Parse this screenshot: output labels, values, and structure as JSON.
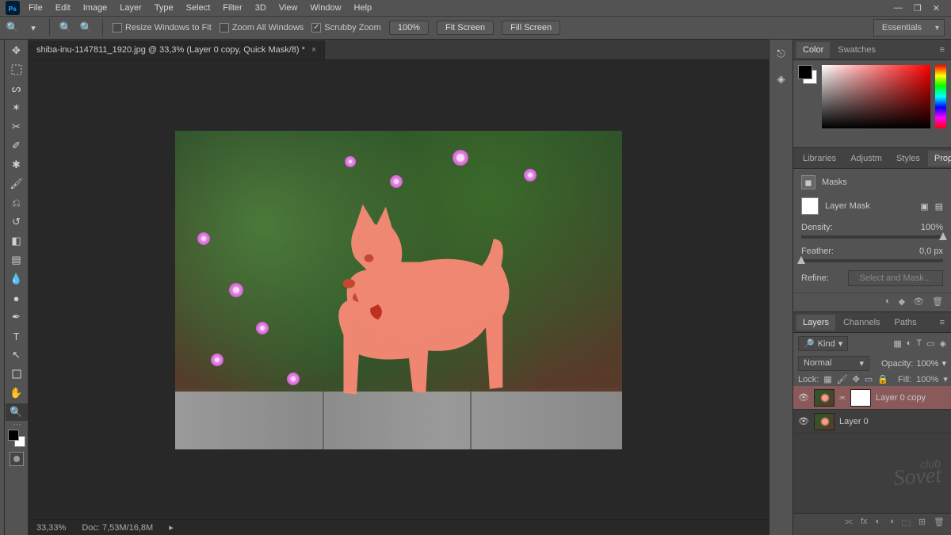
{
  "menubar": {
    "items": [
      "File",
      "Edit",
      "Image",
      "Layer",
      "Type",
      "Select",
      "Filter",
      "3D",
      "View",
      "Window",
      "Help"
    ]
  },
  "optionsBar": {
    "resizeWindows": "Resize Windows to Fit",
    "zoomAll": "Zoom All Windows",
    "scrubby": "Scrubby Zoom",
    "zoomLevel": "100%",
    "fitScreen": "Fit Screen",
    "fillScreen": "Fill Screen",
    "workspace": "Essentials"
  },
  "documentTab": {
    "title": "shiba-inu-1147811_1920.jpg @ 33,3% (Layer 0 copy, Quick Mask/8) *"
  },
  "statusBar": {
    "zoom": "33,33%",
    "docInfo": "Doc: 7,53M/16,8M"
  },
  "panels": {
    "colorTab": "Color",
    "swatchesTab": "Swatches",
    "librariesTab": "Libraries",
    "adjustmTab": "Adjustm",
    "stylesTab": "Styles",
    "propertiesTab": "Properties",
    "layersTab": "Layers",
    "channelsTab": "Channels",
    "pathsTab": "Paths"
  },
  "properties": {
    "masksTitle": "Masks",
    "layerMaskLabel": "Layer Mask",
    "densityLabel": "Density:",
    "densityValue": "100%",
    "featherLabel": "Feather:",
    "featherValue": "0,0 px",
    "refineLabel": "Refine:",
    "selectMaskBtn": "Select and Mask..."
  },
  "layers": {
    "kindLabel": "Kind",
    "blendMode": "Normal",
    "opacityLabel": "Opacity:",
    "opacityValue": "100%",
    "lockLabel": "Lock:",
    "fillLabel": "Fill:",
    "fillValue": "100%",
    "items": [
      {
        "name": "Layer 0 copy",
        "selected": true,
        "hasMask": true
      },
      {
        "name": "Layer 0",
        "selected": false,
        "hasMask": false
      }
    ]
  }
}
